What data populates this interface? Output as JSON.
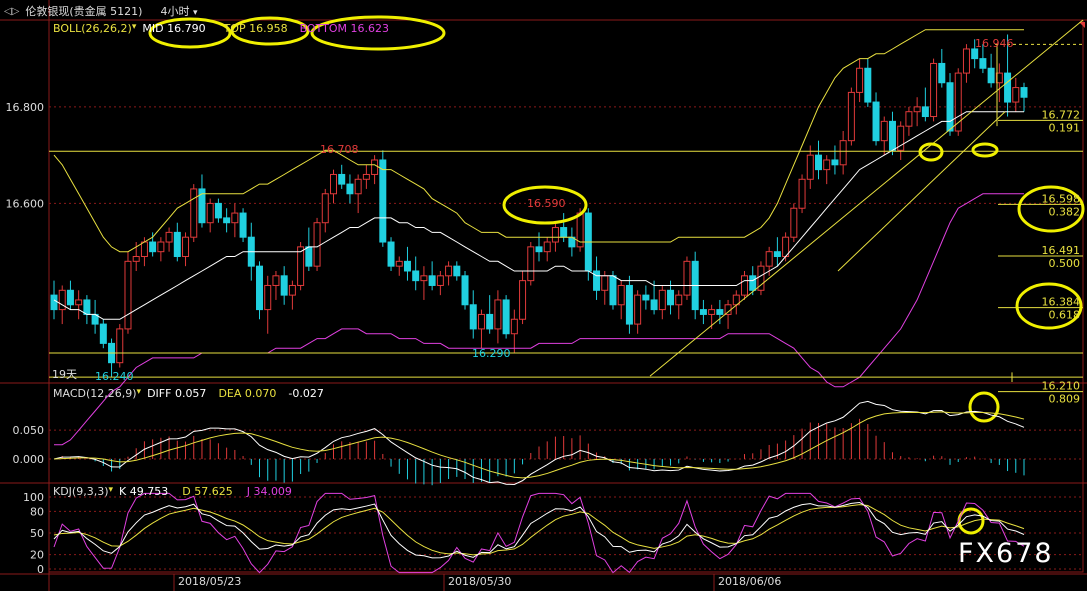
{
  "header": {
    "nav_icon": "back-forward-icon",
    "instrument": "伦敦银现(贵金属 5121)",
    "period": "4小时"
  },
  "boll": {
    "label": "BOLL(26,26,2)",
    "mid": "MID 16.790",
    "top": "TOP 16.958",
    "bottom": "BOTTOM 16.623"
  },
  "macd": {
    "label": "MACD(12,26,9)",
    "diff": "DIFF 0.057",
    "dea": "DEA 0.070",
    "macd": "-0.027"
  },
  "kdj": {
    "label": "KDJ(9,3,3)",
    "k": "K 49.753",
    "d": "D 57.625",
    "j": "J 34.009"
  },
  "price_annotations": {
    "high_label": "16.946",
    "peak_mid": "16.708",
    "mid_swing": "16.590",
    "low_mid": "16.290",
    "low_left": "16.240",
    "days": "19天"
  },
  "fib_levels": [
    {
      "price": "16.772",
      "ratio": "0.191"
    },
    {
      "price": "16.598",
      "ratio": "0.382"
    },
    {
      "price": "16.491",
      "ratio": "0.500"
    },
    {
      "price": "16.384",
      "ratio": "0.618"
    },
    {
      "price": "16.210",
      "ratio": "0.809"
    }
  ],
  "dates": [
    "2018/05/23",
    "2018/05/30",
    "2018/06/06"
  ],
  "watermark": "FX678",
  "chart_data": [
    {
      "type": "candlestick",
      "title": "伦敦银现(贵金属 5121) 4小时",
      "y_ticks": [
        "16.800",
        "16.600"
      ],
      "ylim": [
        16.23,
        16.98
      ],
      "grid": true,
      "colors": {
        "up": "#e03a3a",
        "down": "#20d0e0",
        "mid": "#ffffff",
        "top": "#e8e040",
        "bottom": "#e040e0"
      },
      "ohlc": [
        [
          16.41,
          16.44,
          16.36,
          16.38
        ],
        [
          16.38,
          16.43,
          16.35,
          16.42
        ],
        [
          16.42,
          16.44,
          16.38,
          16.39
        ],
        [
          16.39,
          16.42,
          16.36,
          16.4
        ],
        [
          16.4,
          16.41,
          16.35,
          16.37
        ],
        [
          16.37,
          16.4,
          16.33,
          16.35
        ],
        [
          16.35,
          16.36,
          16.3,
          16.31
        ],
        [
          16.31,
          16.32,
          16.24,
          16.27
        ],
        [
          16.27,
          16.35,
          16.26,
          16.34
        ],
        [
          16.34,
          16.5,
          16.33,
          16.48
        ],
        [
          16.48,
          16.52,
          16.46,
          16.49
        ],
        [
          16.49,
          16.53,
          16.47,
          16.52
        ],
        [
          16.52,
          16.54,
          16.49,
          16.5
        ],
        [
          16.5,
          16.53,
          16.48,
          16.52
        ],
        [
          16.52,
          16.55,
          16.5,
          16.54
        ],
        [
          16.54,
          16.56,
          16.48,
          16.49
        ],
        [
          16.49,
          16.54,
          16.47,
          16.53
        ],
        [
          16.53,
          16.64,
          16.52,
          16.63
        ],
        [
          16.63,
          16.66,
          16.55,
          16.56
        ],
        [
          16.56,
          16.61,
          16.54,
          16.6
        ],
        [
          16.6,
          16.61,
          16.56,
          16.57
        ],
        [
          16.57,
          16.59,
          16.54,
          16.56
        ],
        [
          16.56,
          16.6,
          16.53,
          16.58
        ],
        [
          16.58,
          16.59,
          16.52,
          16.53
        ],
        [
          16.53,
          16.56,
          16.44,
          16.47
        ],
        [
          16.47,
          16.48,
          16.36,
          16.38
        ],
        [
          16.38,
          16.45,
          16.33,
          16.43
        ],
        [
          16.43,
          16.46,
          16.4,
          16.45
        ],
        [
          16.45,
          16.47,
          16.39,
          16.41
        ],
        [
          16.41,
          16.44,
          16.38,
          16.43
        ],
        [
          16.43,
          16.52,
          16.42,
          16.51
        ],
        [
          16.51,
          16.55,
          16.46,
          16.47
        ],
        [
          16.47,
          16.57,
          16.46,
          16.56
        ],
        [
          16.56,
          16.63,
          16.54,
          16.62
        ],
        [
          16.62,
          16.67,
          16.6,
          16.66
        ],
        [
          16.66,
          16.68,
          16.63,
          16.64
        ],
        [
          16.64,
          16.66,
          16.6,
          16.62
        ],
        [
          16.62,
          16.66,
          16.58,
          16.65
        ],
        [
          16.65,
          16.68,
          16.63,
          16.66
        ],
        [
          16.66,
          16.7,
          16.64,
          16.69
        ],
        [
          16.69,
          16.71,
          16.51,
          16.52
        ],
        [
          16.52,
          16.53,
          16.46,
          16.47
        ],
        [
          16.47,
          16.49,
          16.45,
          16.48
        ],
        [
          16.48,
          16.51,
          16.44,
          16.46
        ],
        [
          16.46,
          16.49,
          16.42,
          16.44
        ],
        [
          16.44,
          16.47,
          16.4,
          16.45
        ],
        [
          16.45,
          16.48,
          16.42,
          16.43
        ],
        [
          16.43,
          16.46,
          16.41,
          16.45
        ],
        [
          16.45,
          16.48,
          16.43,
          16.47
        ],
        [
          16.47,
          16.48,
          16.44,
          16.45
        ],
        [
          16.45,
          16.46,
          16.38,
          16.39
        ],
        [
          16.39,
          16.42,
          16.32,
          16.34
        ],
        [
          16.34,
          16.38,
          16.3,
          16.37
        ],
        [
          16.37,
          16.41,
          16.33,
          16.34
        ],
        [
          16.34,
          16.42,
          16.31,
          16.4
        ],
        [
          16.4,
          16.41,
          16.32,
          16.33
        ],
        [
          16.33,
          16.38,
          16.29,
          16.36
        ],
        [
          16.36,
          16.46,
          16.35,
          16.44
        ],
        [
          16.44,
          16.52,
          16.43,
          16.51
        ],
        [
          16.51,
          16.54,
          16.48,
          16.5
        ],
        [
          16.5,
          16.53,
          16.48,
          16.52
        ],
        [
          16.52,
          16.56,
          16.5,
          16.55
        ],
        [
          16.55,
          16.58,
          16.52,
          16.53
        ],
        [
          16.53,
          16.55,
          16.49,
          16.51
        ],
        [
          16.51,
          16.59,
          16.5,
          16.58
        ],
        [
          16.58,
          16.59,
          16.44,
          16.46
        ],
        [
          16.46,
          16.49,
          16.4,
          16.42
        ],
        [
          16.42,
          16.46,
          16.39,
          16.45
        ],
        [
          16.45,
          16.46,
          16.38,
          16.39
        ],
        [
          16.39,
          16.44,
          16.36,
          16.43
        ],
        [
          16.43,
          16.45,
          16.33,
          16.35
        ],
        [
          16.35,
          16.42,
          16.33,
          16.41
        ],
        [
          16.41,
          16.43,
          16.38,
          16.4
        ],
        [
          16.4,
          16.44,
          16.37,
          16.38
        ],
        [
          16.38,
          16.43,
          16.36,
          16.42
        ],
        [
          16.42,
          16.44,
          16.37,
          16.39
        ],
        [
          16.39,
          16.42,
          16.36,
          16.41
        ],
        [
          16.41,
          16.49,
          16.4,
          16.48
        ],
        [
          16.48,
          16.5,
          16.36,
          16.38
        ],
        [
          16.38,
          16.4,
          16.35,
          16.37
        ],
        [
          16.37,
          16.39,
          16.34,
          16.38
        ],
        [
          16.38,
          16.4,
          16.35,
          16.37
        ],
        [
          16.37,
          16.4,
          16.34,
          16.39
        ],
        [
          16.39,
          16.42,
          16.37,
          16.41
        ],
        [
          16.41,
          16.46,
          16.4,
          16.45
        ],
        [
          16.45,
          16.47,
          16.41,
          16.42
        ],
        [
          16.42,
          16.48,
          16.41,
          16.47
        ],
        [
          16.47,
          16.51,
          16.45,
          16.5
        ],
        [
          16.5,
          16.53,
          16.47,
          16.49
        ],
        [
          16.49,
          16.54,
          16.48,
          16.53
        ],
        [
          16.53,
          16.6,
          16.52,
          16.59
        ],
        [
          16.59,
          16.66,
          16.58,
          16.65
        ],
        [
          16.65,
          16.72,
          16.63,
          16.7
        ],
        [
          16.7,
          16.73,
          16.65,
          16.67
        ],
        [
          16.67,
          16.7,
          16.64,
          16.69
        ],
        [
          16.69,
          16.72,
          16.66,
          16.68
        ],
        [
          16.68,
          16.75,
          16.66,
          16.73
        ],
        [
          16.73,
          16.84,
          16.72,
          16.83
        ],
        [
          16.83,
          16.9,
          16.81,
          16.88
        ],
        [
          16.88,
          16.9,
          16.8,
          16.81
        ],
        [
          16.81,
          16.83,
          16.72,
          16.73
        ],
        [
          16.73,
          16.78,
          16.7,
          16.77
        ],
        [
          16.77,
          16.79,
          16.7,
          16.71
        ],
        [
          16.71,
          16.77,
          16.69,
          16.76
        ],
        [
          16.76,
          16.8,
          16.74,
          16.79
        ],
        [
          16.79,
          16.82,
          16.76,
          16.8
        ],
        [
          16.8,
          16.84,
          16.77,
          16.78
        ],
        [
          16.78,
          16.9,
          16.77,
          16.89
        ],
        [
          16.89,
          16.92,
          16.84,
          16.85
        ],
        [
          16.85,
          16.87,
          16.74,
          16.75
        ],
        [
          16.75,
          16.88,
          16.74,
          16.87
        ],
        [
          16.87,
          16.93,
          16.85,
          16.92
        ],
        [
          16.92,
          16.94,
          16.88,
          16.9
        ],
        [
          16.9,
          16.93,
          16.87,
          16.88
        ],
        [
          16.88,
          16.91,
          16.84,
          16.85
        ],
        [
          16.85,
          16.89,
          16.81,
          16.87
        ],
        [
          16.87,
          16.95,
          16.78,
          16.81
        ],
        [
          16.81,
          16.86,
          16.79,
          16.84
        ],
        [
          16.84,
          16.85,
          16.79,
          16.82
        ]
      ],
      "boll_mid": [
        16.4,
        16.39,
        16.38,
        16.38,
        16.37,
        16.37,
        16.36,
        16.36,
        16.36,
        16.37,
        16.38,
        16.39,
        16.4,
        16.41,
        16.42,
        16.43,
        16.44,
        16.45,
        16.46,
        16.47,
        16.48,
        16.49,
        16.49,
        16.5,
        16.5,
        16.5,
        16.5,
        16.5,
        16.5,
        16.5,
        16.5,
        16.51,
        16.51,
        16.52,
        16.53,
        16.54,
        16.55,
        16.55,
        16.56,
        16.57,
        16.57,
        16.57,
        16.56,
        16.56,
        16.55,
        16.55,
        16.54,
        16.54,
        16.53,
        16.52,
        16.51,
        16.5,
        16.49,
        16.48,
        16.48,
        16.47,
        16.46,
        16.46,
        16.46,
        16.46,
        16.46,
        16.47,
        16.47,
        16.46,
        16.46,
        16.46,
        16.45,
        16.45,
        16.45,
        16.44,
        16.44,
        16.44,
        16.44,
        16.43,
        16.43,
        16.43,
        16.43,
        16.43,
        16.43,
        16.43,
        16.43,
        16.43,
        16.43,
        16.43,
        16.44,
        16.44,
        16.45,
        16.46,
        16.47,
        16.49,
        16.51,
        16.53,
        16.55,
        16.57,
        16.59,
        16.61,
        16.63,
        16.65,
        16.67,
        16.68,
        16.69,
        16.7,
        16.71,
        16.72,
        16.73,
        16.74,
        16.75,
        16.76,
        16.77,
        16.77,
        16.78,
        16.79,
        16.79,
        16.79,
        16.79,
        16.79,
        16.79,
        16.79,
        16.79
      ],
      "boll_top": [
        16.7,
        16.68,
        16.65,
        16.62,
        16.59,
        16.56,
        16.53,
        16.51,
        16.5,
        16.5,
        16.51,
        16.52,
        16.53,
        16.55,
        16.57,
        16.59,
        16.6,
        16.61,
        16.62,
        16.62,
        16.62,
        16.62,
        16.62,
        16.62,
        16.63,
        16.64,
        16.64,
        16.65,
        16.66,
        16.67,
        16.68,
        16.69,
        16.7,
        16.71,
        16.71,
        16.7,
        16.69,
        16.68,
        16.68,
        16.68,
        16.67,
        16.67,
        16.66,
        16.65,
        16.64,
        16.63,
        16.61,
        16.6,
        16.59,
        16.58,
        16.56,
        16.55,
        16.54,
        16.54,
        16.54,
        16.53,
        16.53,
        16.53,
        16.53,
        16.53,
        16.53,
        16.53,
        16.53,
        16.53,
        16.52,
        16.52,
        16.52,
        16.52,
        16.52,
        16.52,
        16.52,
        16.52,
        16.52,
        16.52,
        16.52,
        16.52,
        16.53,
        16.53,
        16.53,
        16.53,
        16.53,
        16.53,
        16.53,
        16.53,
        16.53,
        16.54,
        16.55,
        16.57,
        16.6,
        16.64,
        16.68,
        16.72,
        16.76,
        16.8,
        16.83,
        16.86,
        16.88,
        16.89,
        16.9,
        16.9,
        16.91,
        16.91,
        16.92,
        16.93,
        16.94,
        16.95,
        16.96,
        16.96,
        16.96,
        16.96,
        16.96,
        16.96,
        16.96,
        16.96,
        16.96,
        16.96,
        16.96,
        16.96,
        16.96
      ],
      "boll_bottom": [
        16.1,
        16.1,
        16.11,
        16.13,
        16.15,
        16.17,
        16.19,
        16.21,
        16.22,
        16.24,
        16.26,
        16.27,
        16.28,
        16.28,
        16.28,
        16.28,
        16.28,
        16.28,
        16.29,
        16.29,
        16.29,
        16.29,
        16.29,
        16.29,
        16.29,
        16.29,
        16.29,
        16.3,
        16.3,
        16.3,
        16.3,
        16.31,
        16.32,
        16.32,
        16.33,
        16.34,
        16.34,
        16.34,
        16.33,
        16.33,
        16.33,
        16.33,
        16.32,
        16.32,
        16.32,
        16.31,
        16.31,
        16.31,
        16.3,
        16.3,
        16.3,
        16.3,
        16.3,
        16.3,
        16.3,
        16.3,
        16.3,
        16.3,
        16.3,
        16.31,
        16.31,
        16.31,
        16.31,
        16.31,
        16.32,
        16.32,
        16.32,
        16.32,
        16.32,
        16.32,
        16.32,
        16.32,
        16.32,
        16.32,
        16.32,
        16.32,
        16.32,
        16.32,
        16.32,
        16.32,
        16.32,
        16.32,
        16.33,
        16.33,
        16.33,
        16.33,
        16.33,
        16.33,
        16.32,
        16.31,
        16.3,
        16.28,
        16.26,
        16.25,
        16.23,
        16.22,
        16.22,
        16.23,
        16.24,
        16.26,
        16.28,
        16.3,
        16.32,
        16.34,
        16.37,
        16.4,
        16.44,
        16.48,
        16.52,
        16.56,
        16.59,
        16.6,
        16.61,
        16.62,
        16.62,
        16.62,
        16.62,
        16.62,
        16.62
      ]
    },
    {
      "type": "bar+line",
      "title": "MACD(12,26,9)",
      "y_ticks": [
        "0.050",
        "0.000"
      ],
      "ylim": [
        -0.04,
        0.13
      ],
      "grid": true,
      "colors": {
        "diff": "#ffffff",
        "dea": "#e8e040",
        "hist_up": "#e03a3a",
        "hist_down": "#20d0e0"
      },
      "note": "DIFF / DEA lines and MACD histogram, last values DIFF 0.057, DEA 0.070, MACD -0.027"
    },
    {
      "type": "line",
      "title": "KDJ(9,3,3)",
      "y_ticks": [
        "100",
        "80",
        "50",
        "20",
        "0"
      ],
      "ylim": [
        0,
        100
      ],
      "grid": true,
      "colors": {
        "k": "#ffffff",
        "d": "#e8e040",
        "j": "#e040e0"
      },
      "note": "K / D / J oscillator lines, last values K 49.753, D 57.625, J 34.009"
    }
  ]
}
